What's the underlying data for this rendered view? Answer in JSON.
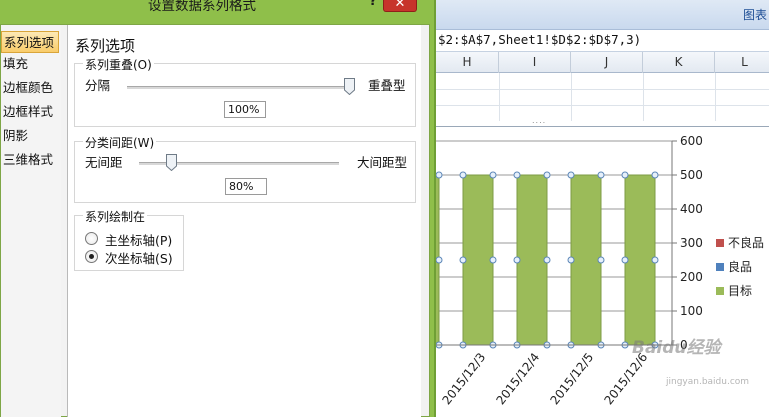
{
  "dialog": {
    "title": "设置数据系列格式",
    "help_label": "?",
    "close_label": "✕",
    "nav": [
      {
        "label": "系列选项",
        "active": true
      },
      {
        "label": "填充",
        "active": false
      },
      {
        "label": "边框颜色",
        "active": false
      },
      {
        "label": "边框样式",
        "active": false
      },
      {
        "label": "阴影",
        "active": false
      },
      {
        "label": "三维格式",
        "active": false
      }
    ],
    "section_title": "系列选项",
    "overlap": {
      "group_label": "系列重叠(O)",
      "left_label": "分隔",
      "right_label": "重叠型",
      "value": "100%",
      "fraction": 1.0
    },
    "gap": {
      "group_label": "分类间距(W)",
      "left_label": "无间距",
      "right_label": "大间距型",
      "value": "80%",
      "fraction": 0.16
    },
    "plot_on": {
      "group_label": "系列绘制在",
      "options": [
        {
          "label": "主坐标轴(P)",
          "selected": false
        },
        {
          "label": "次坐标轴(S)",
          "selected": true
        }
      ]
    }
  },
  "excel": {
    "window_title": "图表",
    "formula": "$2:$A$7,Sheet1!$D$2:$D$7,3)",
    "columns": [
      "H",
      "I",
      "J",
      "K",
      "L"
    ],
    "split_handle": "....",
    "watermark": "Baidu经验",
    "watermark_sub": "jingyan.baidu.com"
  },
  "chart_data": {
    "type": "bar",
    "categories": [
      "",
      "2015/12/3",
      "2015/12/4",
      "2015/12/5",
      "2015/12/6"
    ],
    "series": [
      {
        "name": "目标",
        "values": [
          500,
          500,
          500,
          500,
          500
        ],
        "color": "#9bbb59"
      }
    ],
    "legend": [
      {
        "name": "不良品",
        "color": "#c0504d"
      },
      {
        "name": "良品",
        "color": "#4f81bd"
      },
      {
        "name": "目标",
        "color": "#9bbb59"
      }
    ],
    "y_ticks": [
      "0",
      "100",
      "200",
      "300",
      "400",
      "500",
      "600"
    ],
    "ylim": [
      0,
      600
    ],
    "y_axis_side": "right",
    "grid": true,
    "legend_placement": "right",
    "selected_series_markers": true
  }
}
